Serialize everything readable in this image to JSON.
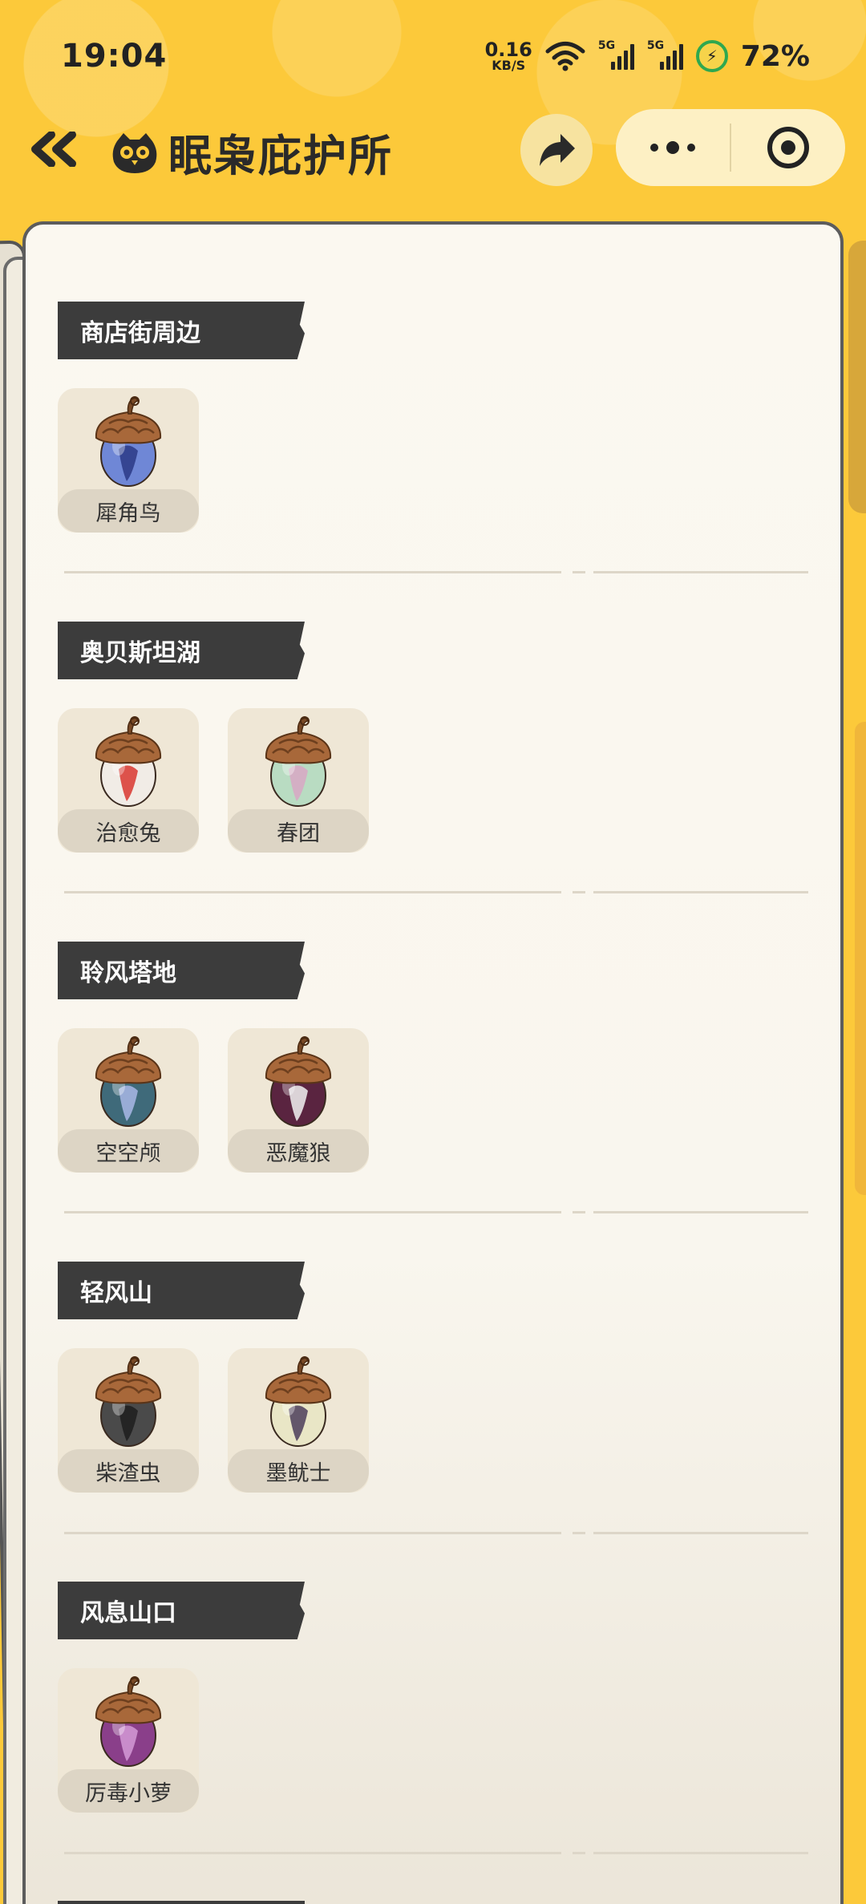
{
  "status_bar": {
    "time": "19:04",
    "net_speed_value": "0.16",
    "net_speed_unit": "KB/S",
    "signal1_label": "5G",
    "signal2_label": "5G",
    "battery_percent": "72%"
  },
  "header": {
    "title": "眠枭庇护所",
    "icons": [
      "back-double-chevron-icon",
      "owl-logo-icon",
      "share-arrow-icon",
      "more-dots-icon",
      "target-close-icon"
    ]
  },
  "sections": [
    {
      "label": "商店街周边",
      "pets": [
        {
          "name": "犀角鸟",
          "shell": "#6f87d6",
          "accent": "#2b3a86"
        }
      ]
    },
    {
      "label": "奥贝斯坦湖",
      "pets": [
        {
          "name": "治愈兔",
          "shell": "#f1ece6",
          "accent": "#d9372f"
        },
        {
          "name": "春团",
          "shell": "#b9dcc2",
          "accent": "#d8a7c4"
        }
      ]
    },
    {
      "label": "聆风塔地",
      "pets": [
        {
          "name": "空空颅",
          "shell": "#3f6a7a",
          "accent": "#a9b7e6"
        },
        {
          "name": "恶魔狼",
          "shell": "#5a2440",
          "accent": "#f2f2f2"
        }
      ]
    },
    {
      "label": "轻风山",
      "pets": [
        {
          "name": "柴渣虫",
          "shell": "#4a4a4a",
          "accent": "#1d1d1d"
        },
        {
          "name": "墨鱿士",
          "shell": "#e9e6c6",
          "accent": "#4c3d5a"
        }
      ]
    },
    {
      "label": "风息山口",
      "pets": [
        {
          "name": "厉毒小萝",
          "shell": "#8a3f8a",
          "accent": "#d39ad6"
        }
      ]
    }
  ],
  "colors": {
    "background": "#fcc93a",
    "paper": "#fbf8f0",
    "section_label_bg": "#3c3c3c"
  }
}
